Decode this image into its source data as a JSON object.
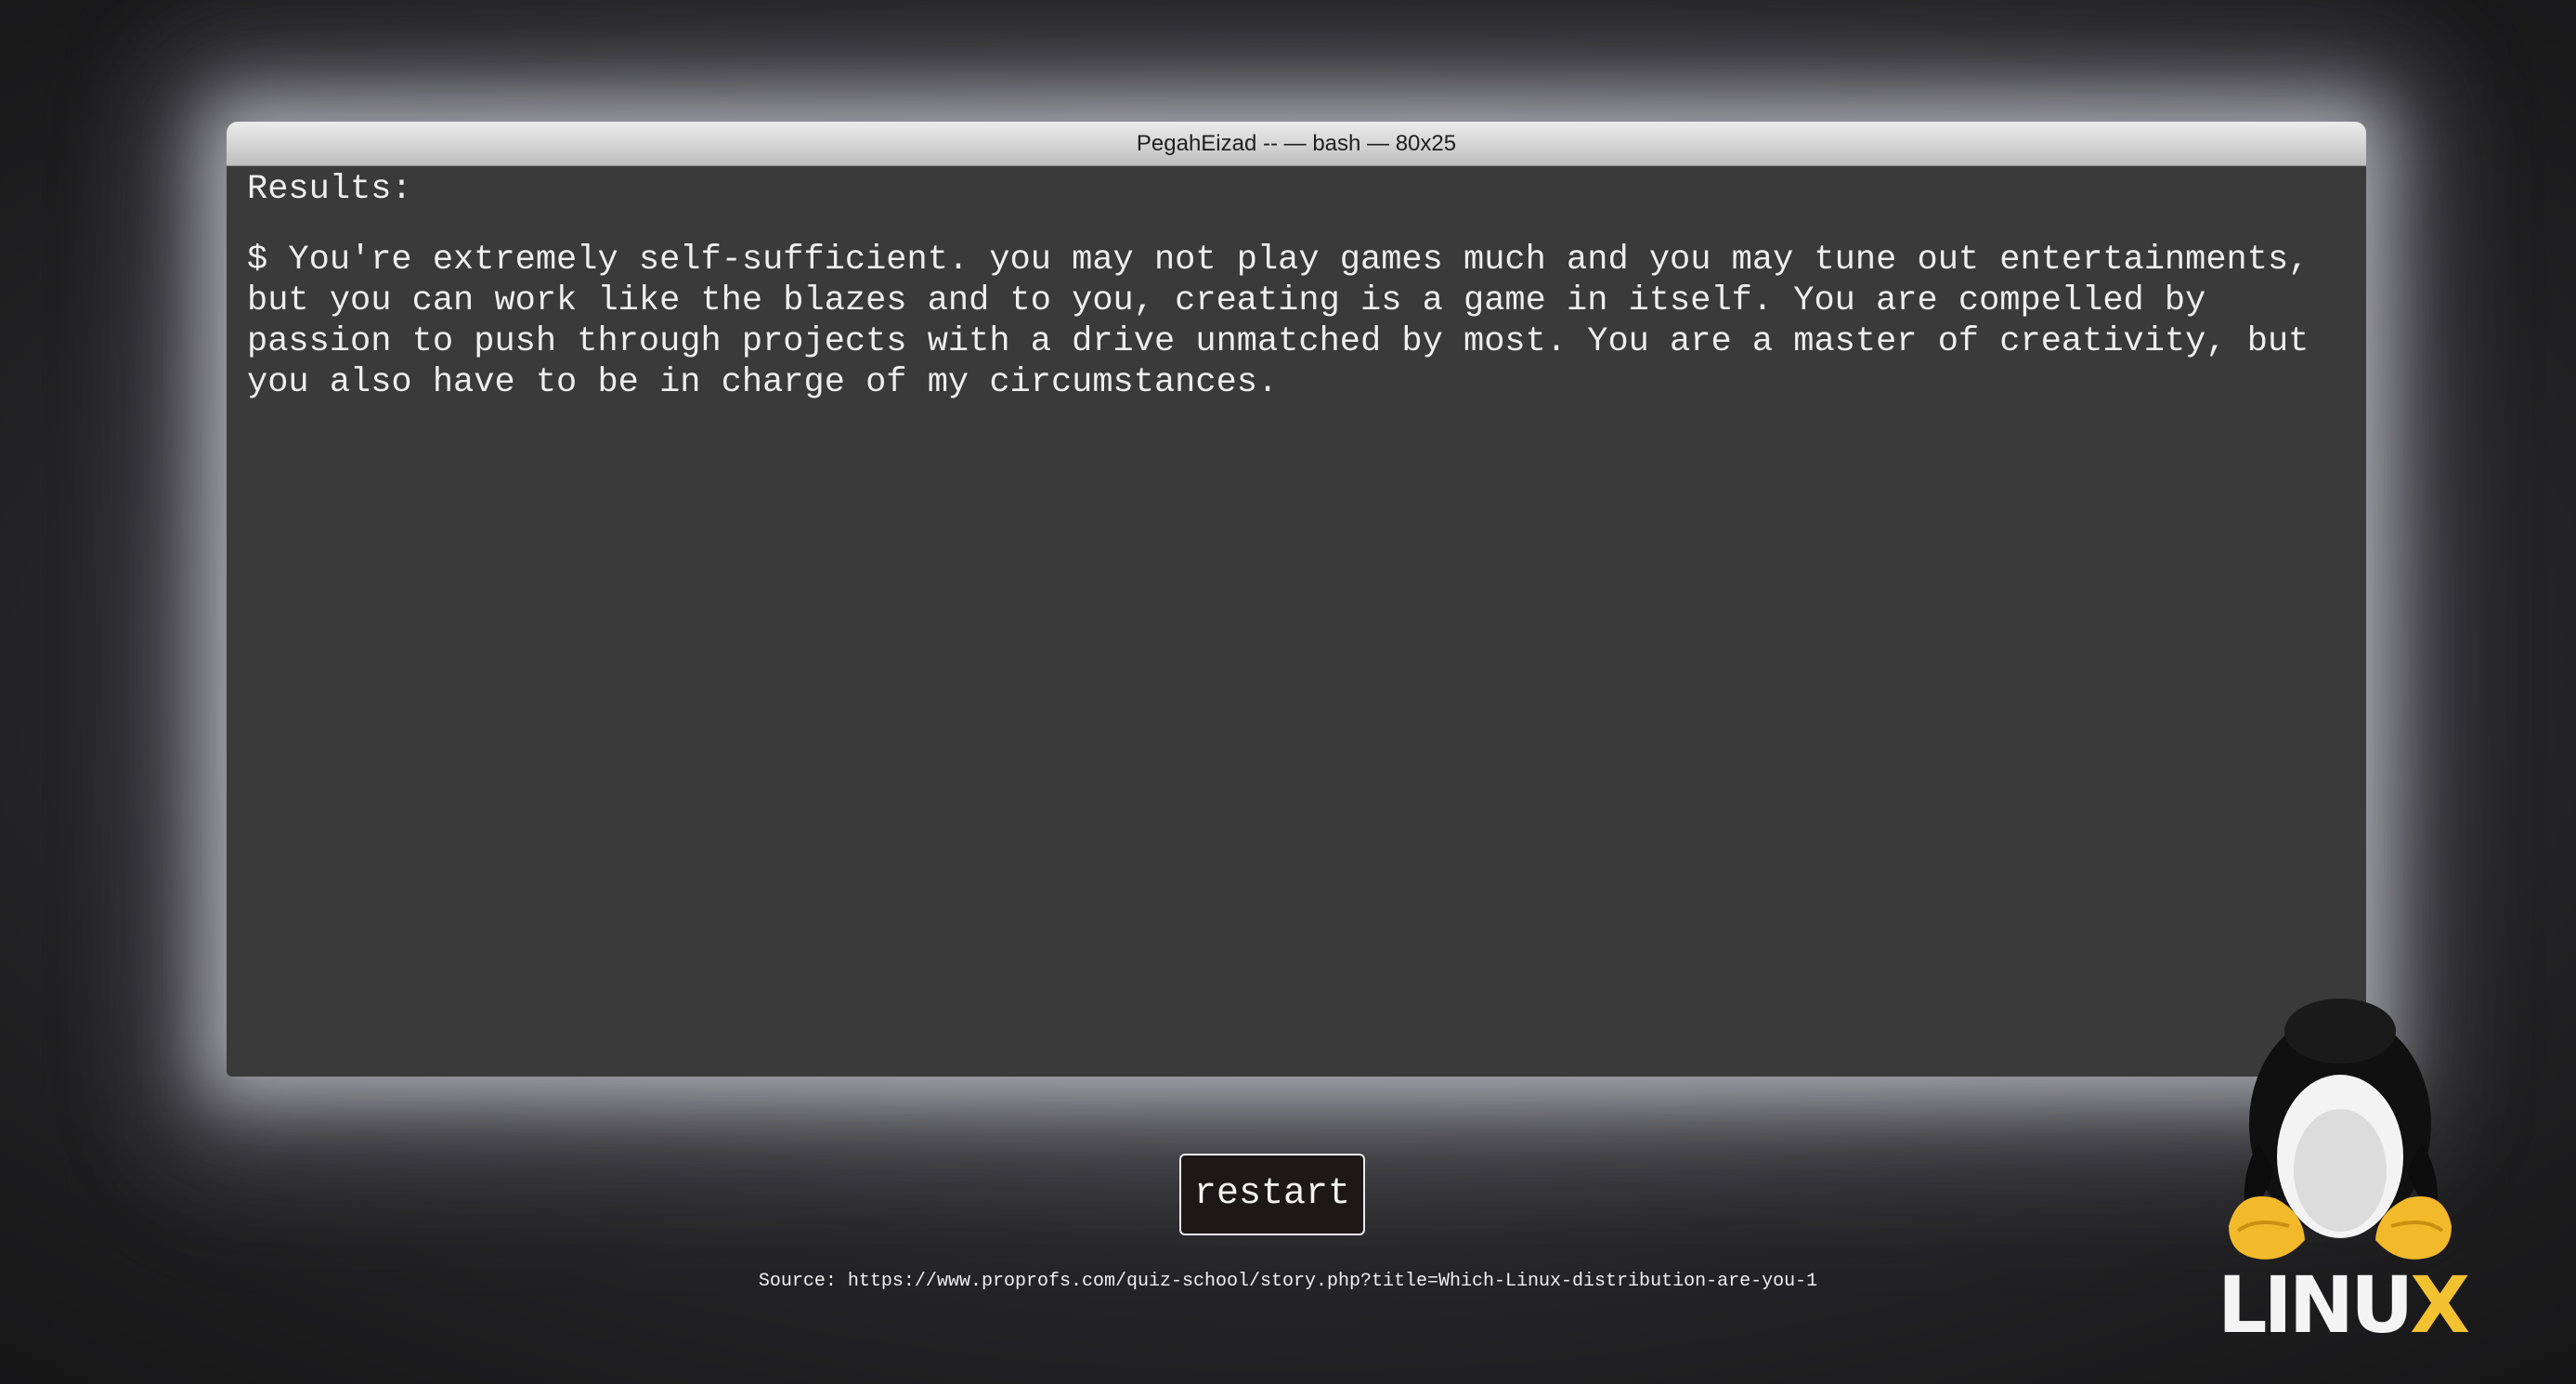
{
  "window": {
    "title": "PegahEizad -- — bash — 80x25"
  },
  "terminal": {
    "results_label": "Results:",
    "result_text": "$ You're extremely self-sufficient. you may not play games much and you may tune out entertainments, but you can work like the blazes and to you, creating is a game in itself. You are compelled by passion to push through projects with a drive unmatched by most. You are a master of creativity, but you also have to be in charge of my circumstances."
  },
  "controls": {
    "restart_label": "restart"
  },
  "footer": {
    "source_text": "Source: https://www.proprofs.com/quiz-school/story.php?title=Which-Linux-distribution-are-you-1"
  },
  "logo": {
    "text_main": "LINU",
    "text_accent": "X",
    "icon": "tux-penguin-icon"
  },
  "colors": {
    "terminal_bg": "#3a3a3a",
    "page_bg": "#1a1a1c",
    "logo_accent": "#f2c230"
  }
}
